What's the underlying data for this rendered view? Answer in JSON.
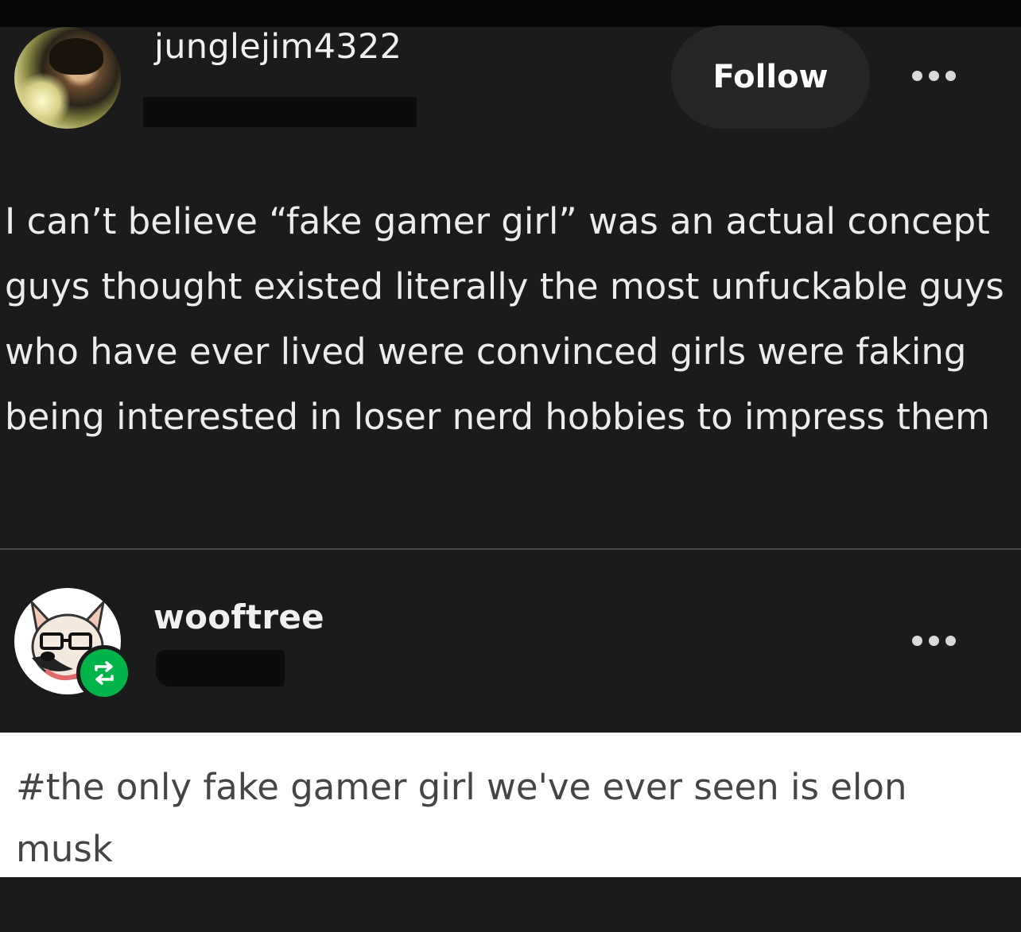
{
  "post": {
    "username": "junglejim4322",
    "follow_label": "Follow",
    "text": "I can’t believe “fake gamer girl” was an actual concept guys thought existed literally the most unfuckable guys who have ever lived were convinced girls were faking being interested in loser nerd hobbies to impress them"
  },
  "reblog": {
    "username": "wooftree",
    "tag": "#the only fake gamer girl we've ever seen is elon musk"
  },
  "icons": {
    "more": "more-options-icon",
    "reblog": "reblog-icon"
  },
  "colors": {
    "background": "#1b1b1b",
    "follow_button": "#262626",
    "reblog_badge": "#00b44a",
    "tag_panel": "#ffffff"
  }
}
